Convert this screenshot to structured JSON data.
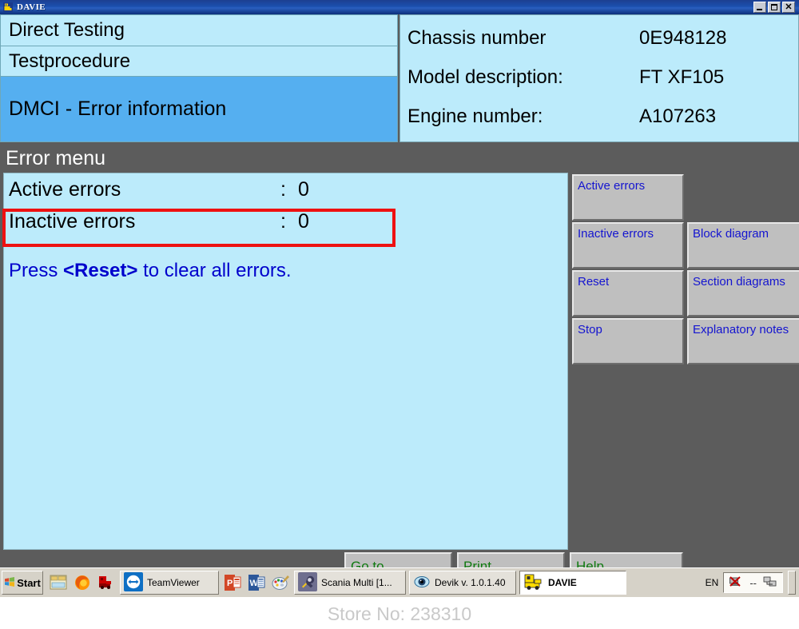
{
  "window": {
    "title": "DAVIE",
    "icon": "davie-truck-icon",
    "controls": {
      "minimize": "_",
      "maximize": "□",
      "close": "✕"
    }
  },
  "nav": {
    "rows": [
      {
        "label": "Direct Testing",
        "selected": false
      },
      {
        "label": "Testprocedure",
        "selected": false
      },
      {
        "label": "DMCI - Error information",
        "selected": true
      }
    ]
  },
  "vehicle_info": {
    "rows": [
      {
        "label": "Chassis number",
        "value": "0E948128"
      },
      {
        "label": "Model description:",
        "value": "FT XF105"
      },
      {
        "label": "Engine number:",
        "value": "A107263"
      }
    ]
  },
  "section": {
    "header": "Error menu"
  },
  "error_menu": {
    "rows": [
      {
        "label": "Active errors",
        "separator": ":",
        "value": "0",
        "highlighted": false
      },
      {
        "label": "Inactive errors",
        "separator": ":",
        "value": "0",
        "highlighted": true
      }
    ],
    "hint_prefix": "Press ",
    "hint_keyword": "<Reset>",
    "hint_suffix": " to clear all errors."
  },
  "side_buttons": {
    "column_a": [
      "Active errors",
      "Inactive errors",
      "Reset",
      "Stop"
    ],
    "column_b": [
      "Block diagram",
      "Section diagrams",
      "Explanatory notes"
    ]
  },
  "bottom_buttons": [
    "Go to",
    "Print",
    "Help"
  ],
  "taskbar": {
    "start_label": "Start",
    "quick_launch": [
      "folder-window-icon",
      "firefox-icon",
      "red-truck-icon"
    ],
    "items": [
      {
        "label": "TeamViewer",
        "icon": "teamviewer-icon",
        "active": false
      },
      {
        "label": "",
        "icon": "powerpoint-icon",
        "active": false
      },
      {
        "label": "",
        "icon": "word-icon",
        "active": false
      },
      {
        "label": "",
        "icon": "paint-icon",
        "active": false
      },
      {
        "label": "Scania Multi   [1...",
        "icon": "scania-multi-icon",
        "active": false
      },
      {
        "label": "Devik v. 1.0.1.40",
        "icon": "devik-eye-icon",
        "active": false
      },
      {
        "label": "DAVIE",
        "icon": "davie-truck-icon",
        "active": true
      }
    ],
    "tray": {
      "language": "EN",
      "icons": [
        "network-disconnected-icon",
        "dashes-icon",
        "network-link-icon"
      ]
    }
  },
  "watermark": {
    "text": "Store No: 238310"
  },
  "colors": {
    "panel_light_blue": "#bcebfb",
    "selected_row_blue": "#55aff0",
    "chrome_gray": "#5c5c5c",
    "button_face": "#bfbfbf",
    "button_text_blue": "#1414d0",
    "bottom_button_text_green": "#107a10",
    "highlight_red": "#ee1111",
    "titlebar_blue": "#1b4fae"
  }
}
